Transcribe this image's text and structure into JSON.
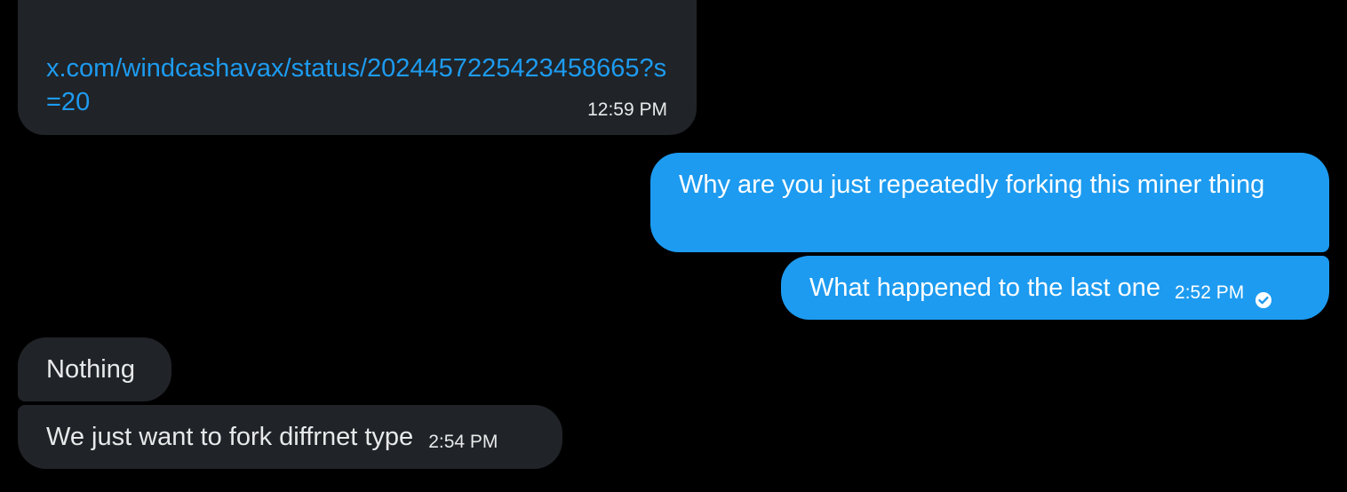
{
  "conversation": {
    "messages": [
      {
        "direction": "received",
        "link": "x.com/windcashavax/status/2024457225423458665?s=20",
        "time": "12:59 PM"
      },
      {
        "direction": "sent",
        "text": "Why are you just repeatedly forking this miner thing"
      },
      {
        "direction": "sent",
        "text": "What happened to the last one",
        "time": "2:52 PM",
        "status_icon": "check-circle-icon"
      },
      {
        "direction": "received",
        "text": "Nothing"
      },
      {
        "direction": "received",
        "text": "We just want to fork diffrnet type",
        "time": "2:54 PM"
      }
    ]
  },
  "colors": {
    "background": "#000000",
    "received_bubble": "#202327",
    "sent_bubble": "#1d9bf0",
    "link": "#1d9bf0",
    "text": "#e7e9ea"
  }
}
